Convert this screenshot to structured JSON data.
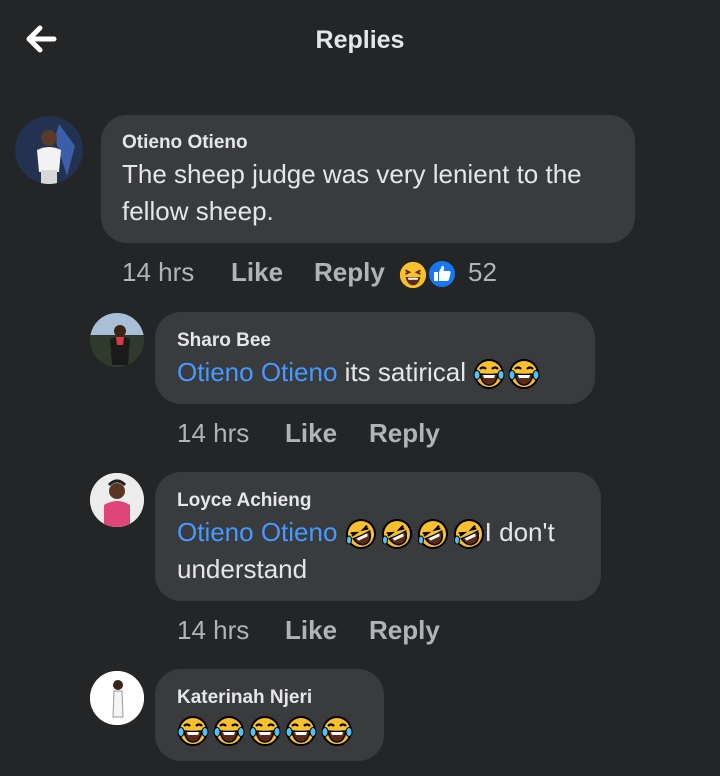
{
  "header": {
    "title": "Replies"
  },
  "comments": [
    {
      "author": "Otieno Otieno",
      "text_line1": "The sheep judge was very lenient to the",
      "text_line2": "fellow sheep.",
      "time": "14 hrs",
      "like_label": "Like",
      "reply_label": "Reply",
      "reactions": [
        "laughing",
        "like"
      ],
      "reaction_count": "52"
    },
    {
      "author": "Sharo Bee",
      "mention": "Otieno Otieno",
      "text": "its satirical",
      "emojis": [
        "tears-of-joy",
        "tears-of-joy"
      ],
      "time": "14 hrs",
      "like_label": "Like",
      "reply_label": "Reply"
    },
    {
      "author": "Loyce Achieng",
      "mention": "Otieno Otieno",
      "emojis": [
        "rofl",
        "rofl",
        "rofl",
        "rofl"
      ],
      "text_tail": "I don't",
      "text_line2": "understand",
      "time": "14 hrs",
      "like_label": "Like",
      "reply_label": "Reply"
    },
    {
      "author": "Katerinah Njeri",
      "emojis": [
        "tears-of-joy",
        "tears-of-joy",
        "tears-of-joy",
        "tears-of-joy",
        "tears-of-joy"
      ]
    }
  ],
  "colors": {
    "background": "#242526",
    "bubble": "#3a3b3c",
    "text": "#e4e6eb",
    "meta": "#b0b3b8",
    "mention": "#4599ff",
    "like_blue": "#1877f2",
    "emoji_yellow": "#fbc02d"
  }
}
